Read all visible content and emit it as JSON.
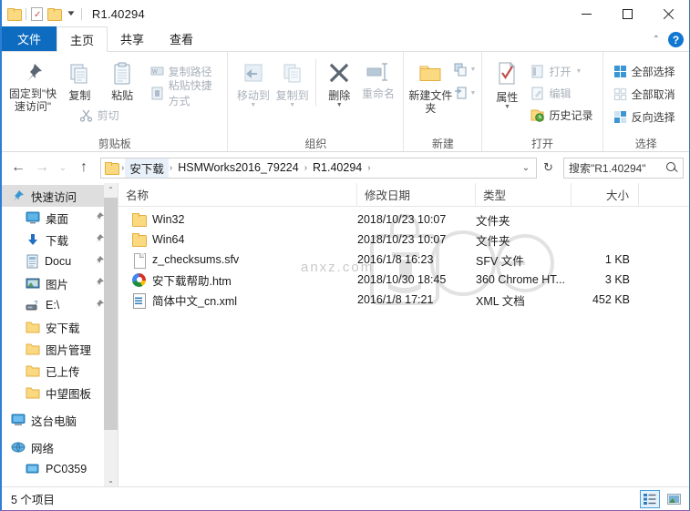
{
  "window": {
    "title": "R1.40294",
    "quick_access_toolbar": [
      {
        "name": "folder-icon",
        "label": ""
      },
      {
        "name": "properties-icon",
        "label": ""
      },
      {
        "name": "new-folder-icon",
        "label": ""
      },
      {
        "name": "customize-dropdown",
        "label": "▼"
      }
    ],
    "controls": {
      "minimize": "—",
      "maximize": "□",
      "close": "✕"
    }
  },
  "tabs": [
    {
      "id": "file",
      "label": "文件"
    },
    {
      "id": "home",
      "label": "主页"
    },
    {
      "id": "share",
      "label": "共享"
    },
    {
      "id": "view",
      "label": "查看"
    }
  ],
  "tabstrip_right": {
    "collapse": "⌃",
    "help": "?"
  },
  "ribbon": {
    "groups": [
      {
        "name": "剪贴板",
        "big_buttons": [
          {
            "label": "固定到\"快速访问\"",
            "icon": "pin-icon",
            "dim": false
          },
          {
            "label": "复制",
            "icon": "copy-icon",
            "dim": false
          },
          {
            "label": "粘贴",
            "icon": "paste-icon",
            "dim": false
          }
        ],
        "small_buttons": [
          {
            "label": "复制路径",
            "icon": "copy-path-icon",
            "dim": true
          },
          {
            "label": "粘贴快捷方式",
            "icon": "paste-shortcut-icon",
            "dim": true
          },
          {
            "label": "剪切",
            "icon": "cut-icon",
            "dim": true
          }
        ]
      },
      {
        "name": "组织",
        "big_buttons": [
          {
            "label": "移动到",
            "icon": "move-to-icon",
            "dim": true
          },
          {
            "label": "复制到",
            "icon": "copy-to-icon",
            "dim": true
          },
          {
            "label": "删除",
            "icon": "delete-icon",
            "dim": false
          },
          {
            "label": "重命名",
            "icon": "rename-icon",
            "dim": true
          }
        ],
        "small_buttons": []
      },
      {
        "name": "新建",
        "big_buttons": [
          {
            "label": "新建文件夹",
            "icon": "new-folder-icon",
            "dim": false
          }
        ],
        "small_buttons": [
          {
            "label": "",
            "icon": "new-item-icon",
            "dim": true
          },
          {
            "label": "",
            "icon": "easy-access-icon",
            "dim": true
          }
        ]
      },
      {
        "name": "打开",
        "big_buttons": [
          {
            "label": "属性",
            "icon": "properties-icon",
            "dim": false
          }
        ],
        "small_buttons": [
          {
            "label": "打开",
            "icon": "open-icon",
            "dim": true
          },
          {
            "label": "编辑",
            "icon": "edit-icon",
            "dim": true
          },
          {
            "label": "历史记录",
            "icon": "history-icon",
            "dim": false
          }
        ]
      },
      {
        "name": "选择",
        "big_buttons": [],
        "small_buttons": [
          {
            "label": "全部选择",
            "icon": "select-all-icon",
            "dim": false
          },
          {
            "label": "全部取消",
            "icon": "select-none-icon",
            "dim": false
          },
          {
            "label": "反向选择",
            "icon": "invert-selection-icon",
            "dim": false
          }
        ]
      }
    ]
  },
  "address_bar": {
    "back": "←",
    "forward": "→",
    "recent": "⌄",
    "up": "↑",
    "breadcrumbs": [
      "安下载",
      "HSMWorks2016_79224",
      "R1.40294"
    ],
    "dropdown": "⌄",
    "refresh": "↻",
    "search_value": "搜索\"R1.40294\"",
    "search_placeholder": "搜索\"R1.40294\""
  },
  "sidebar": {
    "items": [
      {
        "label": "快速访问",
        "icon": "quick-access-star-icon",
        "selected": true,
        "pinned": false,
        "indent": 0
      },
      {
        "label": "桌面",
        "icon": "desktop-icon",
        "selected": false,
        "pinned": true,
        "indent": 1
      },
      {
        "label": "下载",
        "icon": "downloads-icon",
        "selected": false,
        "pinned": true,
        "indent": 1
      },
      {
        "label": "Docu",
        "icon": "documents-icon",
        "selected": false,
        "pinned": true,
        "indent": 1
      },
      {
        "label": "图片",
        "icon": "pictures-icon",
        "selected": false,
        "pinned": true,
        "indent": 1
      },
      {
        "label": "E:\\",
        "icon": "drive-icon",
        "selected": false,
        "pinned": true,
        "indent": 1
      },
      {
        "label": "安下载",
        "icon": "folder-icon",
        "selected": false,
        "pinned": false,
        "indent": 1
      },
      {
        "label": "图片管理",
        "icon": "folder-icon",
        "selected": false,
        "pinned": false,
        "indent": 1
      },
      {
        "label": "已上传",
        "icon": "folder-icon",
        "selected": false,
        "pinned": false,
        "indent": 1
      },
      {
        "label": "中望图板",
        "icon": "folder-icon",
        "selected": false,
        "pinned": false,
        "indent": 1
      },
      {
        "label": "这台电脑",
        "icon": "this-pc-icon",
        "selected": false,
        "pinned": false,
        "indent": 0
      },
      {
        "label": "网络",
        "icon": "network-icon",
        "selected": false,
        "pinned": false,
        "indent": 0
      },
      {
        "label": "PC0359",
        "icon": "computer-icon",
        "selected": false,
        "pinned": false,
        "indent": 1
      }
    ],
    "scroll_up": "⌃",
    "scroll_down": "⌄"
  },
  "file_list": {
    "columns": [
      "名称",
      "修改日期",
      "类型",
      "大小"
    ],
    "rows": [
      {
        "name": "Win32",
        "icon": "folder-icon",
        "date": "2018/10/23 10:07",
        "type": "文件夹",
        "size": ""
      },
      {
        "name": "Win64",
        "icon": "folder-icon",
        "date": "2018/10/23 10:07",
        "type": "文件夹",
        "size": ""
      },
      {
        "name": "z_checksums.sfv",
        "icon": "generic-file-icon",
        "date": "2016/1/8 16:23",
        "type": "SFV 文件",
        "size": "1 KB"
      },
      {
        "name": "安下载帮助.htm",
        "icon": "chrome-html-icon",
        "date": "2018/10/30 18:45",
        "type": "360 Chrome HT...",
        "size": "3 KB"
      },
      {
        "name": "简体中文_cn.xml",
        "icon": "xml-file-icon",
        "date": "2016/1/8 17:21",
        "type": "XML 文档",
        "size": "452 KB"
      }
    ],
    "watermark_text": "anxz.com",
    "watermark_mark": "安"
  },
  "status_bar": {
    "item_count": "5 个项目",
    "view_details": "details-view-icon",
    "view_large": "large-icons-view-icon"
  },
  "colors": {
    "accent_blue": "#0d6cc0",
    "folder_yellow": "#fbd981",
    "selection_gray": "#dedede",
    "border_left": "#2e7fd4",
    "border_bottom": "#8a5fa8"
  }
}
